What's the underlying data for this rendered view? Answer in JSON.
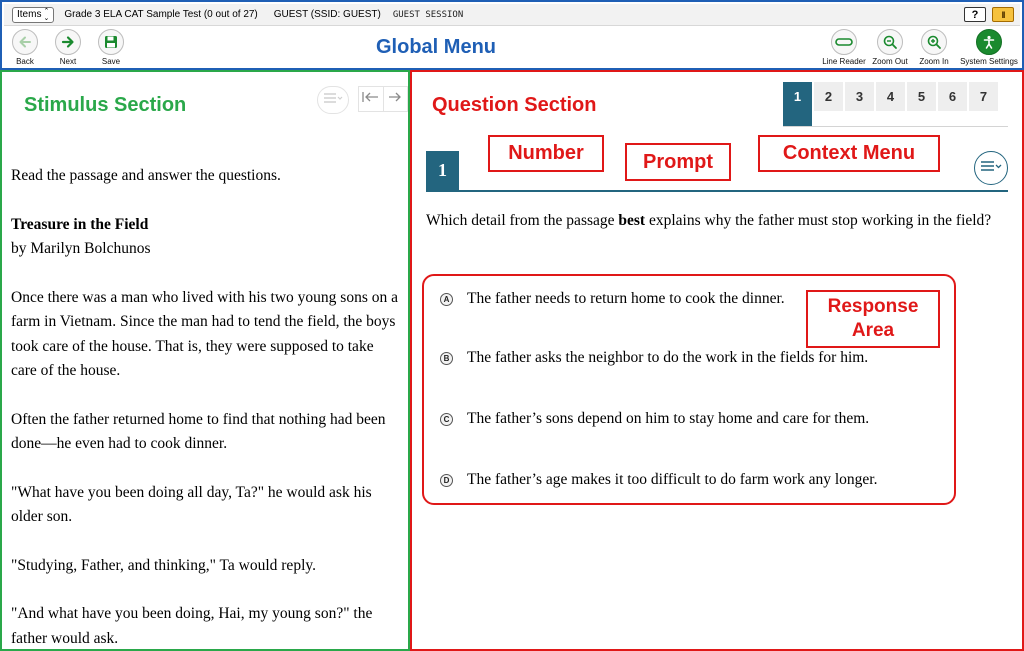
{
  "topbar": {
    "items_label": "Items",
    "test_title": "Grade 3 ELA CAT Sample Test (0 out of 27)",
    "guest_name": "GUEST (SSID: GUEST)",
    "session": "GUEST SESSION",
    "help_label": "?",
    "pause_label": "II"
  },
  "toolbar": {
    "back_label": "Back",
    "next_label": "Next",
    "save_label": "Save",
    "line_reader_label": "Line Reader",
    "zoom_out_label": "Zoom Out",
    "zoom_in_label": "Zoom In",
    "system_settings_label": "System Settings",
    "accent_color": "#1a8a2e"
  },
  "annotations": {
    "global_menu": "Global Menu",
    "stimulus_section": "Stimulus Section",
    "question_section": "Question Section",
    "number": "Number",
    "prompt": "Prompt",
    "context_menu": "Context Menu",
    "response_area_line1": "Response",
    "response_area_line2": "Area"
  },
  "stimulus": {
    "intro": "Read the passage and answer the questions.",
    "title": "Treasure in the Field",
    "author": "by Marilyn Bolchunos",
    "paragraphs": [
      "Once there was a man who lived with his two young sons on a farm in Vietnam. Since the man had to tend the field, the boys took care of the house. That is, they were supposed to take care of the house.",
      "Often the father returned home to find that nothing had been done—he even had to cook dinner.",
      "\"What have you been doing all day, Ta?\" he would ask his older son.",
      "\"Studying, Father, and thinking,\" Ta would reply.",
      "\"And what have you been doing, Hai, my young son?\" the father would ask."
    ]
  },
  "question": {
    "tabs": [
      "1",
      "2",
      "3",
      "4",
      "5",
      "6",
      "7"
    ],
    "active_tab": "1",
    "number": "1",
    "prompt_before": "Which detail from the passage ",
    "prompt_bold": "best",
    "prompt_after": " explains why the father must stop working in the field?",
    "options": [
      {
        "letter": "A",
        "text": "The father needs to return home to cook the dinner."
      },
      {
        "letter": "B",
        "text": "The father asks the neighbor to do the work in the fields for him."
      },
      {
        "letter": "C",
        "text": "The father’s sons depend on him to stay home and care for them."
      },
      {
        "letter": "D",
        "text": "The father’s age makes it too difficult to do farm work any longer."
      }
    ],
    "theme_color": "#23657f"
  },
  "colors": {
    "global_border": "#1f5fb5",
    "stimulus_border": "#2aa84a",
    "question_border": "#e01818"
  }
}
